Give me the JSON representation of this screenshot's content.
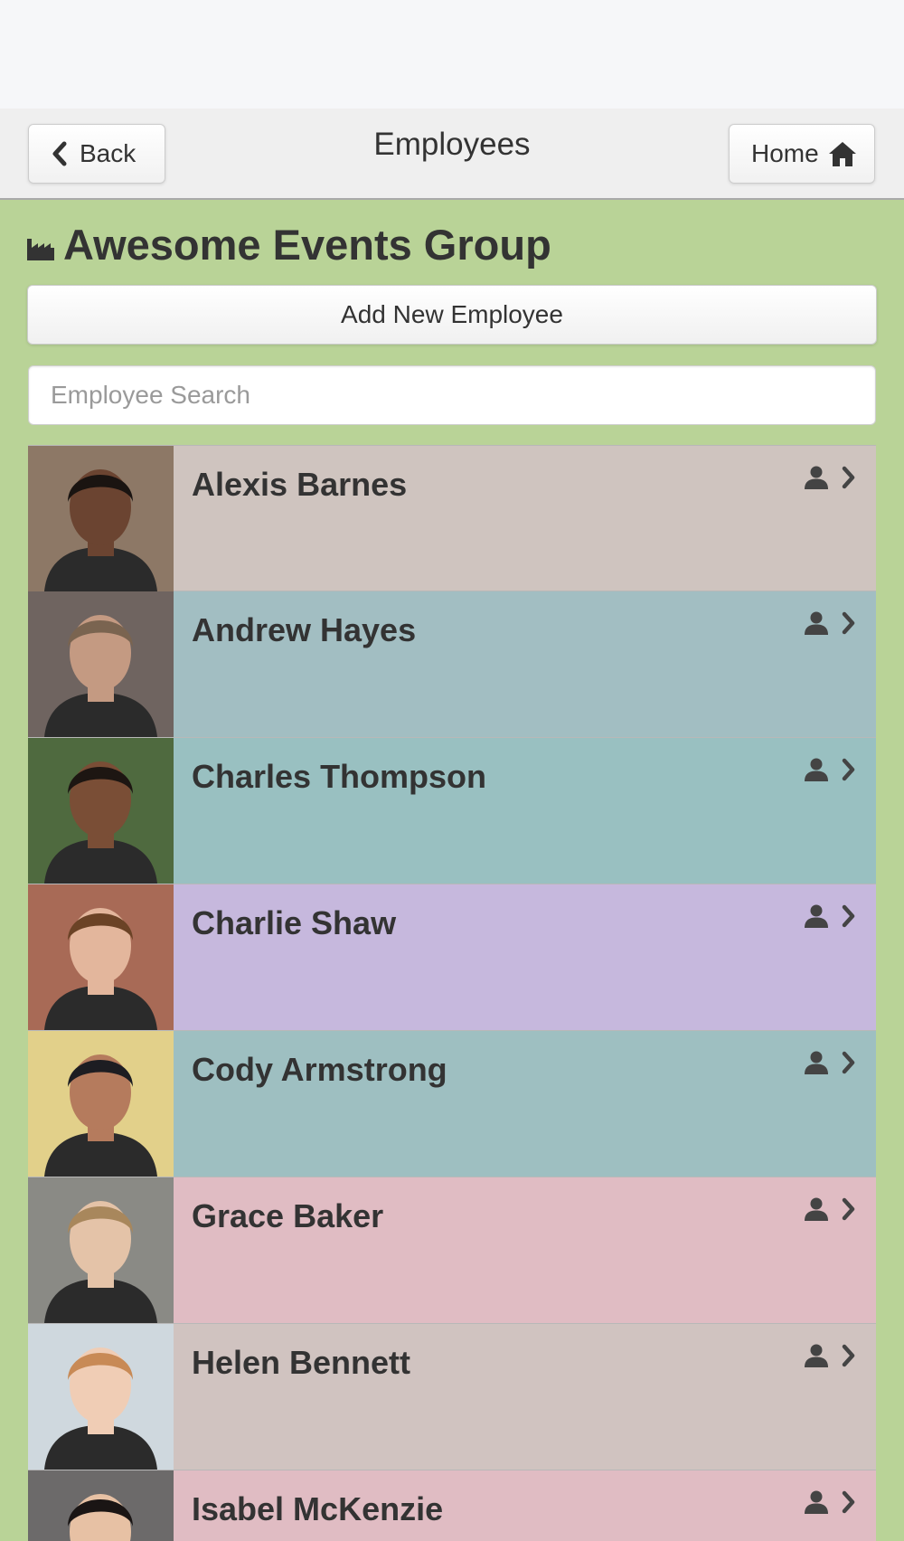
{
  "header": {
    "title": "Employees",
    "back_label": "Back",
    "home_label": "Home"
  },
  "company": {
    "name": "Awesome Events Group",
    "icon": "industry-icon"
  },
  "add_button_label": "Add New Employee",
  "search": {
    "placeholder": "Employee Search",
    "value": ""
  },
  "employees": [
    {
      "name": "Alexis Barnes",
      "color": "#cfc4bf",
      "icon": "person-icon"
    },
    {
      "name": "Andrew Hayes",
      "color": "#a2bec2",
      "icon": "person-icon"
    },
    {
      "name": "Charles Thompson",
      "color": "#99c0c1",
      "icon": "person-icon"
    },
    {
      "name": "Charlie Shaw",
      "color": "#c6b8dd",
      "icon": "person-icon"
    },
    {
      "name": "Cody Armstrong",
      "color": "#9ebfc1",
      "icon": "person-icon"
    },
    {
      "name": "Grace Baker",
      "color": "#e0bcc3",
      "icon": "person-icon"
    },
    {
      "name": "Helen Bennett",
      "color": "#d0c3c0",
      "icon": "person-icon"
    },
    {
      "name": "Isabel McKenzie",
      "color": "#e0bcc3",
      "icon": "person-icon"
    }
  ]
}
